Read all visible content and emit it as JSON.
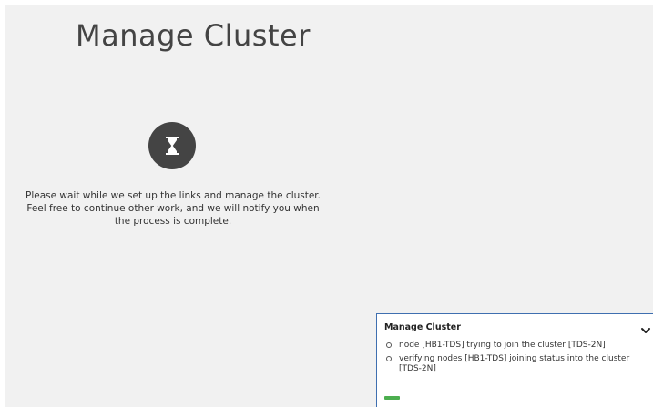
{
  "page": {
    "title": "Manage Cluster",
    "wait_message": "Please wait while we set up the links and manage the cluster. Feel free to continue other work, and we will notify you when the process is complete.",
    "status_icon": "hourglass-icon"
  },
  "notification": {
    "title": "Manage Cluster",
    "toggle_icon": "chevron-down-icon",
    "items": [
      "node [HB1-TDS] trying to join the cluster [TDS-2N]",
      "verifying nodes [HB1-TDS] joining status into the cluster [TDS-2N]"
    ],
    "progress_fraction": 0.06,
    "progress_color": "#4cae4f",
    "border_color": "#3f6fb0"
  }
}
